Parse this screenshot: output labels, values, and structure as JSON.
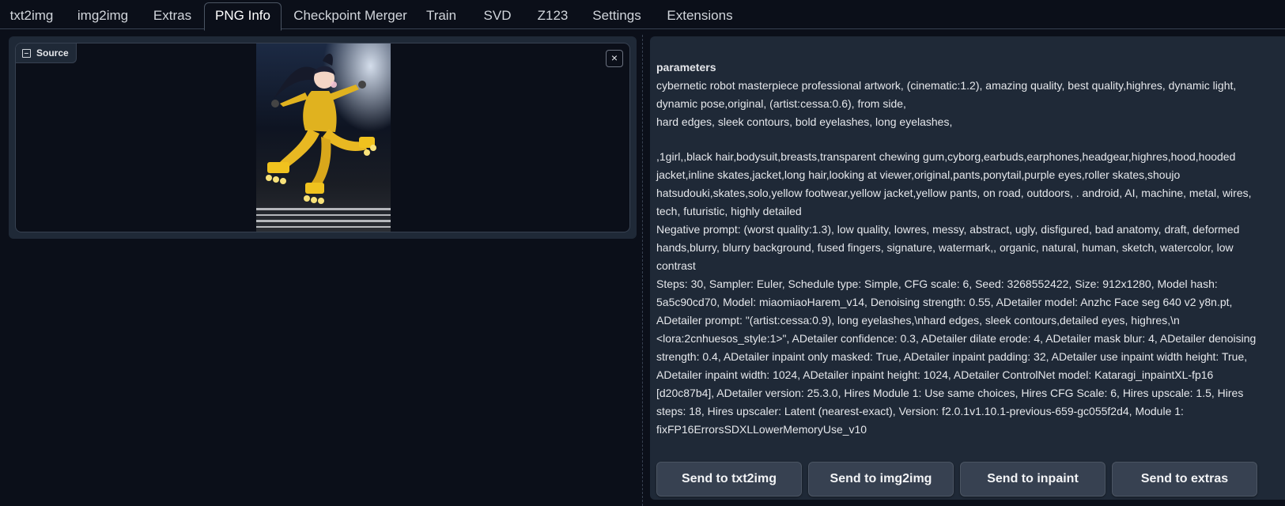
{
  "tabs": [
    {
      "label": "txt2img"
    },
    {
      "label": "img2img"
    },
    {
      "label": "Extras"
    },
    {
      "label": "PNG Info",
      "active": true
    },
    {
      "label": "Checkpoint Merger"
    },
    {
      "label": "Train"
    },
    {
      "label": "SVD"
    },
    {
      "label": "Z123"
    },
    {
      "label": "Settings"
    },
    {
      "label": "Extensions"
    }
  ],
  "source": {
    "label": "Source",
    "close_glyph": "×",
    "image_description": "anime robot girl in yellow bodysuit on inline skates"
  },
  "info": {
    "heading": "parameters",
    "prompt_line1": "cybernetic robot masterpiece professional artwork, (cinematic:1.2), amazing quality, best quality,highres, dynamic light, dynamic pose,original, (artist:cessa:0.6), from side,",
    "prompt_line2": "hard edges, sleek contours, bold eyelashes, long eyelashes,",
    "prompt_line3": ",1girl,,black hair,bodysuit,breasts,transparent chewing gum,cyborg,earbuds,earphones,headgear,highres,hood,hooded jacket,inline skates,jacket,long hair,looking at viewer,original,pants,ponytail,purple eyes,roller skates,shoujo hatsudouki,skates,solo,yellow footwear,yellow jacket,yellow pants, on road, outdoors, . android, AI, machine, metal, wires, tech, futuristic, highly detailed",
    "negative": "Negative prompt: (worst quality:1.3), low quality, lowres, messy, abstract, ugly, disfigured, bad anatomy, draft, deformed hands,blurry, blurry background, fused fingers, signature, watermark,, organic, natural, human, sketch, watercolor, low contrast",
    "settings": "Steps: 30, Sampler: Euler, Schedule type: Simple, CFG scale: 6, Seed: 3268552422, Size: 912x1280, Model hash: 5a5c90cd70, Model: miaomiaoHarem_v14, Denoising strength: 0.55, ADetailer model: Anzhc Face seg 640 v2 y8n.pt, ADetailer prompt: \"(artist:cessa:0.9), long eyelashes,\\nhard edges, sleek contours,detailed eyes, highres,\\n <lora:2cnhuesos_style:1>\", ADetailer confidence: 0.3, ADetailer dilate erode: 4, ADetailer mask blur: 4, ADetailer denoising strength: 0.4, ADetailer inpaint only masked: True, ADetailer inpaint padding: 32, ADetailer use inpaint width height: True, ADetailer inpaint width: 1024, ADetailer inpaint height: 1024, ADetailer ControlNet model: Kataragi_inpaintXL-fp16 [d20c87b4], ADetailer version: 25.3.0, Hires Module 1: Use same choices, Hires CFG Scale: 6, Hires upscale: 1.5, Hires steps: 18, Hires upscaler: Latent (nearest-exact), Version: f2.0.1v1.10.1-previous-659-gc055f2d4, Module 1: fixFP16ErrorsSDXLLowerMemoryUse_v10"
  },
  "buttons": {
    "txt2img": "Send to txt2img",
    "img2img": "Send to img2img",
    "inpaint": "Send to inpaint",
    "extras": "Send to extras"
  }
}
